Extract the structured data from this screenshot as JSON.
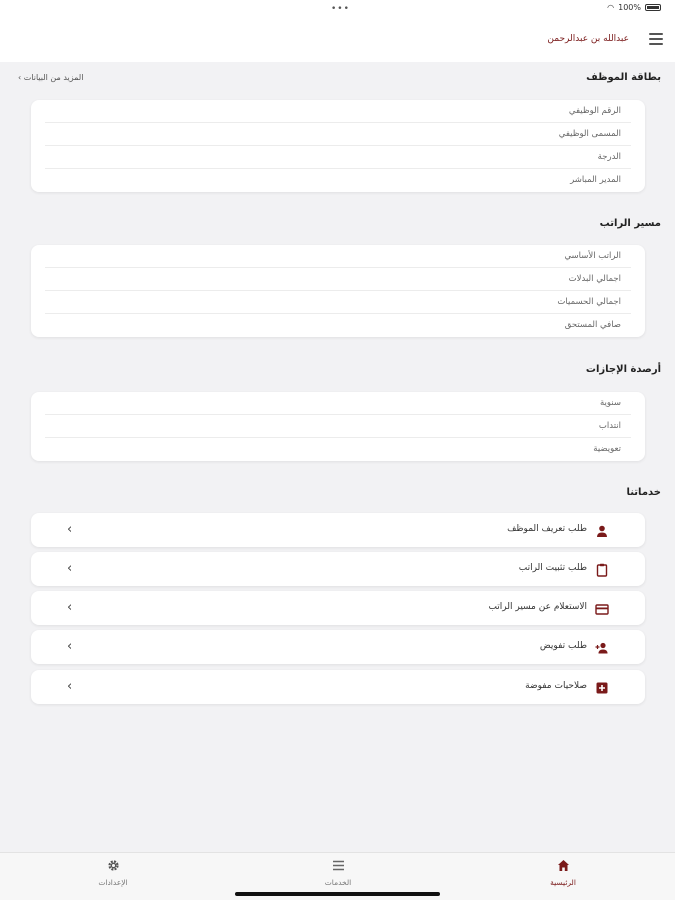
{
  "status_bar": {
    "dots": "•••",
    "battery_text": "100%"
  },
  "header": {
    "user_name": "عبدالله بن عبدالرحمن",
    "menu_icon": "hamburger-icon"
  },
  "employee_card": {
    "title": "بطاقة الموظف",
    "more_link": "المزيد من البيانات ›",
    "rows": [
      "الرقم الوظيفي",
      "المسمى الوظيفي",
      "الدرجة",
      "المدير المباشر"
    ]
  },
  "salary": {
    "title": "مسير الراتب",
    "rows": [
      "الراتب الأساسي",
      "اجمالي البدلات",
      "اجمالي الحسميات",
      "صافي المستحق"
    ]
  },
  "leave_balances": {
    "title": "أرصدة الإجازات",
    "rows": [
      "سنوية",
      "انتداب",
      "تعويضية"
    ]
  },
  "services": {
    "title": "خدماتنا",
    "items": [
      {
        "label": "طلب تعريف الموظف",
        "icon": "person-icon"
      },
      {
        "label": "طلب تثبيت الراتب",
        "icon": "clipboard-icon"
      },
      {
        "label": "الاستعلام عن مسير الراتب",
        "icon": "card-icon"
      },
      {
        "label": "طلب تفويض",
        "icon": "person-add-icon"
      },
      {
        "label": "صلاحيات مفوضة",
        "icon": "plus-box-icon"
      }
    ]
  },
  "tabbar": {
    "tabs": [
      {
        "label": "الرئيسية",
        "icon": "home-icon",
        "active": true
      },
      {
        "label": "الخدمات",
        "icon": "list-icon",
        "active": false
      },
      {
        "label": "الإعدادات",
        "icon": "gear-icon",
        "active": false
      }
    ]
  },
  "colors": {
    "accent": "#7a1a1a",
    "background": "#f2f2f4",
    "card": "#ffffff"
  }
}
